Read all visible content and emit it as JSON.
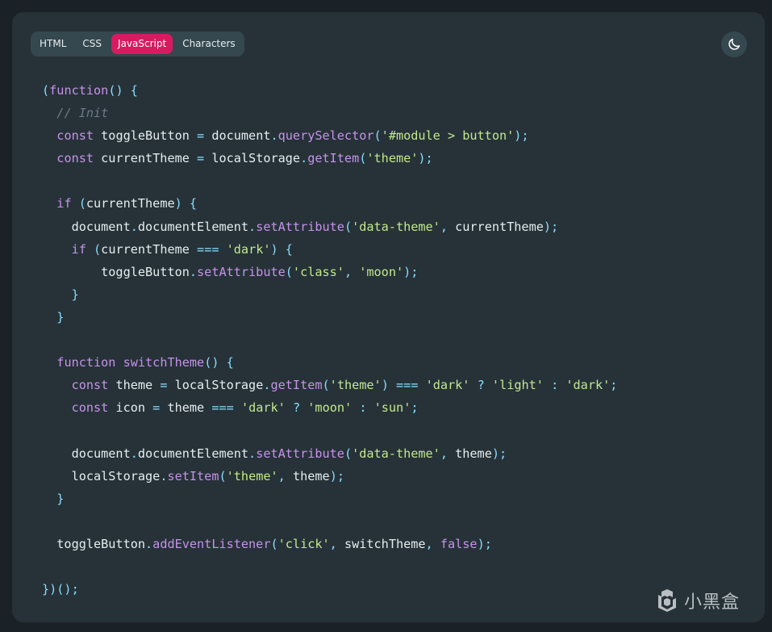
{
  "tabs": [
    {
      "label": "HTML",
      "active": false
    },
    {
      "label": "CSS",
      "active": false
    },
    {
      "label": "JavaScript",
      "active": true
    },
    {
      "label": "Characters",
      "active": false
    }
  ],
  "theme_toggle": {
    "icon": "moon-icon"
  },
  "colors": {
    "background": "#1b2227",
    "panel": "#263238",
    "tab_bar": "#35474f",
    "tab_active": "#d81b60",
    "text": "#e6edf0",
    "punctuation": "#89ddff",
    "keyword": "#c792ea",
    "string": "#c3e88d",
    "comment": "#697b85"
  },
  "code_lines": [
    [
      [
        "punc",
        "("
      ],
      [
        "keyword",
        "function"
      ],
      [
        "punc",
        "() {"
      ]
    ],
    [
      [
        "plain",
        "  "
      ],
      [
        "comment",
        "// Init"
      ]
    ],
    [
      [
        "plain",
        "  "
      ],
      [
        "keyword",
        "const"
      ],
      [
        "plain",
        " toggleButton "
      ],
      [
        "punc",
        "="
      ],
      [
        "plain",
        " document"
      ],
      [
        "punc",
        "."
      ],
      [
        "func",
        "querySelector"
      ],
      [
        "punc",
        "("
      ],
      [
        "string",
        "'#module > button'"
      ],
      [
        "punc",
        ");"
      ]
    ],
    [
      [
        "plain",
        "  "
      ],
      [
        "keyword",
        "const"
      ],
      [
        "plain",
        " currentTheme "
      ],
      [
        "punc",
        "="
      ],
      [
        "plain",
        " localStorage"
      ],
      [
        "punc",
        "."
      ],
      [
        "func",
        "getItem"
      ],
      [
        "punc",
        "("
      ],
      [
        "string",
        "'theme'"
      ],
      [
        "punc",
        ");"
      ]
    ],
    [],
    [
      [
        "plain",
        "  "
      ],
      [
        "keyword",
        "if"
      ],
      [
        "punc",
        " ("
      ],
      [
        "plain",
        "currentTheme"
      ],
      [
        "punc",
        ") {"
      ]
    ],
    [
      [
        "plain",
        "    document"
      ],
      [
        "punc",
        "."
      ],
      [
        "plain",
        "documentElement"
      ],
      [
        "punc",
        "."
      ],
      [
        "func",
        "setAttribute"
      ],
      [
        "punc",
        "("
      ],
      [
        "string",
        "'data-theme'"
      ],
      [
        "punc",
        ","
      ],
      [
        "plain",
        " currentTheme"
      ],
      [
        "punc",
        ");"
      ]
    ],
    [
      [
        "plain",
        "    "
      ],
      [
        "keyword",
        "if"
      ],
      [
        "punc",
        " ("
      ],
      [
        "plain",
        "currentTheme "
      ],
      [
        "punc",
        "==="
      ],
      [
        "plain",
        " "
      ],
      [
        "string",
        "'dark'"
      ],
      [
        "punc",
        ") {"
      ]
    ],
    [
      [
        "plain",
        "        toggleButton"
      ],
      [
        "punc",
        "."
      ],
      [
        "func",
        "setAttribute"
      ],
      [
        "punc",
        "("
      ],
      [
        "string",
        "'class'"
      ],
      [
        "punc",
        ","
      ],
      [
        "plain",
        " "
      ],
      [
        "string",
        "'moon'"
      ],
      [
        "punc",
        ");"
      ]
    ],
    [
      [
        "plain",
        "    "
      ],
      [
        "punc",
        "}"
      ]
    ],
    [
      [
        "plain",
        "  "
      ],
      [
        "punc",
        "}"
      ]
    ],
    [],
    [
      [
        "plain",
        "  "
      ],
      [
        "keyword",
        "function"
      ],
      [
        "plain",
        " "
      ],
      [
        "func",
        "switchTheme"
      ],
      [
        "punc",
        "() {"
      ]
    ],
    [
      [
        "plain",
        "    "
      ],
      [
        "keyword",
        "const"
      ],
      [
        "plain",
        " theme "
      ],
      [
        "punc",
        "="
      ],
      [
        "plain",
        " localStorage"
      ],
      [
        "punc",
        "."
      ],
      [
        "func",
        "getItem"
      ],
      [
        "punc",
        "("
      ],
      [
        "string",
        "'theme'"
      ],
      [
        "punc",
        ") ==="
      ],
      [
        "plain",
        " "
      ],
      [
        "string",
        "'dark'"
      ],
      [
        "plain",
        " "
      ],
      [
        "punc",
        "?"
      ],
      [
        "plain",
        " "
      ],
      [
        "string",
        "'light'"
      ],
      [
        "plain",
        " "
      ],
      [
        "punc",
        ":"
      ],
      [
        "plain",
        " "
      ],
      [
        "string",
        "'dark'"
      ],
      [
        "punc",
        ";"
      ]
    ],
    [
      [
        "plain",
        "    "
      ],
      [
        "keyword",
        "const"
      ],
      [
        "plain",
        " icon "
      ],
      [
        "punc",
        "="
      ],
      [
        "plain",
        " theme "
      ],
      [
        "punc",
        "==="
      ],
      [
        "plain",
        " "
      ],
      [
        "string",
        "'dark'"
      ],
      [
        "plain",
        " "
      ],
      [
        "punc",
        "?"
      ],
      [
        "plain",
        " "
      ],
      [
        "string",
        "'moon'"
      ],
      [
        "plain",
        " "
      ],
      [
        "punc",
        ":"
      ],
      [
        "plain",
        " "
      ],
      [
        "string",
        "'sun'"
      ],
      [
        "punc",
        ";"
      ]
    ],
    [],
    [
      [
        "plain",
        "    document"
      ],
      [
        "punc",
        "."
      ],
      [
        "plain",
        "documentElement"
      ],
      [
        "punc",
        "."
      ],
      [
        "func",
        "setAttribute"
      ],
      [
        "punc",
        "("
      ],
      [
        "string",
        "'data-theme'"
      ],
      [
        "punc",
        ","
      ],
      [
        "plain",
        " theme"
      ],
      [
        "punc",
        ");"
      ]
    ],
    [
      [
        "plain",
        "    localStorage"
      ],
      [
        "punc",
        "."
      ],
      [
        "func",
        "setItem"
      ],
      [
        "punc",
        "("
      ],
      [
        "string",
        "'theme'"
      ],
      [
        "punc",
        ","
      ],
      [
        "plain",
        " theme"
      ],
      [
        "punc",
        ");"
      ]
    ],
    [
      [
        "plain",
        "  "
      ],
      [
        "punc",
        "}"
      ]
    ],
    [],
    [
      [
        "plain",
        "  toggleButton"
      ],
      [
        "punc",
        "."
      ],
      [
        "func",
        "addEventListener"
      ],
      [
        "punc",
        "("
      ],
      [
        "string",
        "'click'"
      ],
      [
        "punc",
        ","
      ],
      [
        "plain",
        " switchTheme"
      ],
      [
        "punc",
        ","
      ],
      [
        "plain",
        " "
      ],
      [
        "keyword",
        "false"
      ],
      [
        "punc",
        ");"
      ]
    ],
    [],
    [
      [
        "punc",
        "})();"
      ]
    ]
  ],
  "watermark": {
    "text": "小黑盒",
    "icon": "heybox-logo-icon"
  }
}
